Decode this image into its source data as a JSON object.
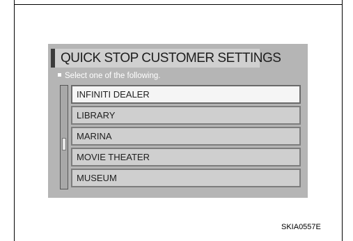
{
  "screen": {
    "title": "QUICK STOP CUSTOMER SETTINGS",
    "subtitle": "Select one of the following.",
    "items": [
      {
        "label": "INFINITI DEALER",
        "selected": true
      },
      {
        "label": "LIBRARY",
        "selected": false
      },
      {
        "label": "MARINA",
        "selected": false
      },
      {
        "label": "MOVIE THEATER",
        "selected": false
      },
      {
        "label": "MUSEUM",
        "selected": false
      }
    ]
  },
  "figure_code": "SKIA0557E",
  "colors": {
    "screen_background": "#b5b5b5",
    "selected_item": "#f5f5f5",
    "unselected_item": "#cfcfcf",
    "title_accent": "#3c3c3c"
  }
}
